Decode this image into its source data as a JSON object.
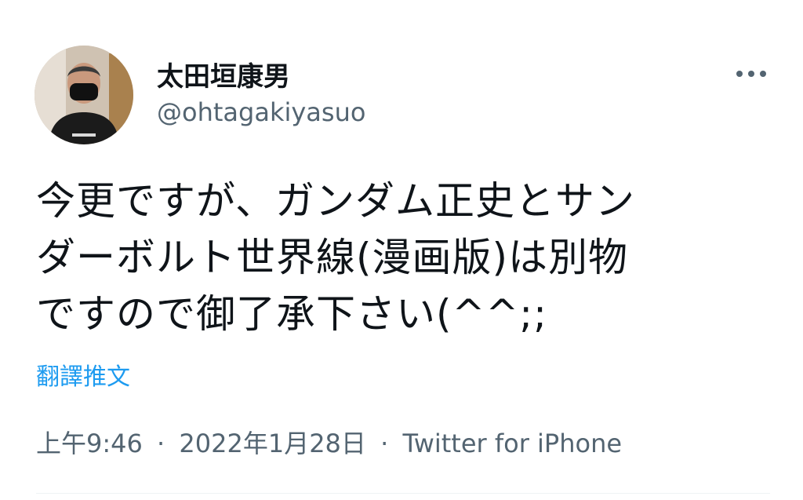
{
  "author": {
    "display_name": "太田垣康男",
    "handle": "@ohtagakiyasuo",
    "avatar_icon": "profile-photo"
  },
  "more_icon": "ellipsis-icon",
  "tweet": {
    "text": "今更ですが、ガンダム正史とサン\nダーボルト世界線(漫画版)は別物\nですので御了承下さい(^^;;",
    "translate_label": "翻譯推文"
  },
  "meta": {
    "time": "上午9:46",
    "separator": "·",
    "date": "2022年1月28日",
    "source": "Twitter for iPhone"
  },
  "colors": {
    "text": "#0f1419",
    "secondary": "#536471",
    "link": "#1d9bf0",
    "divider": "#eff3f4"
  }
}
